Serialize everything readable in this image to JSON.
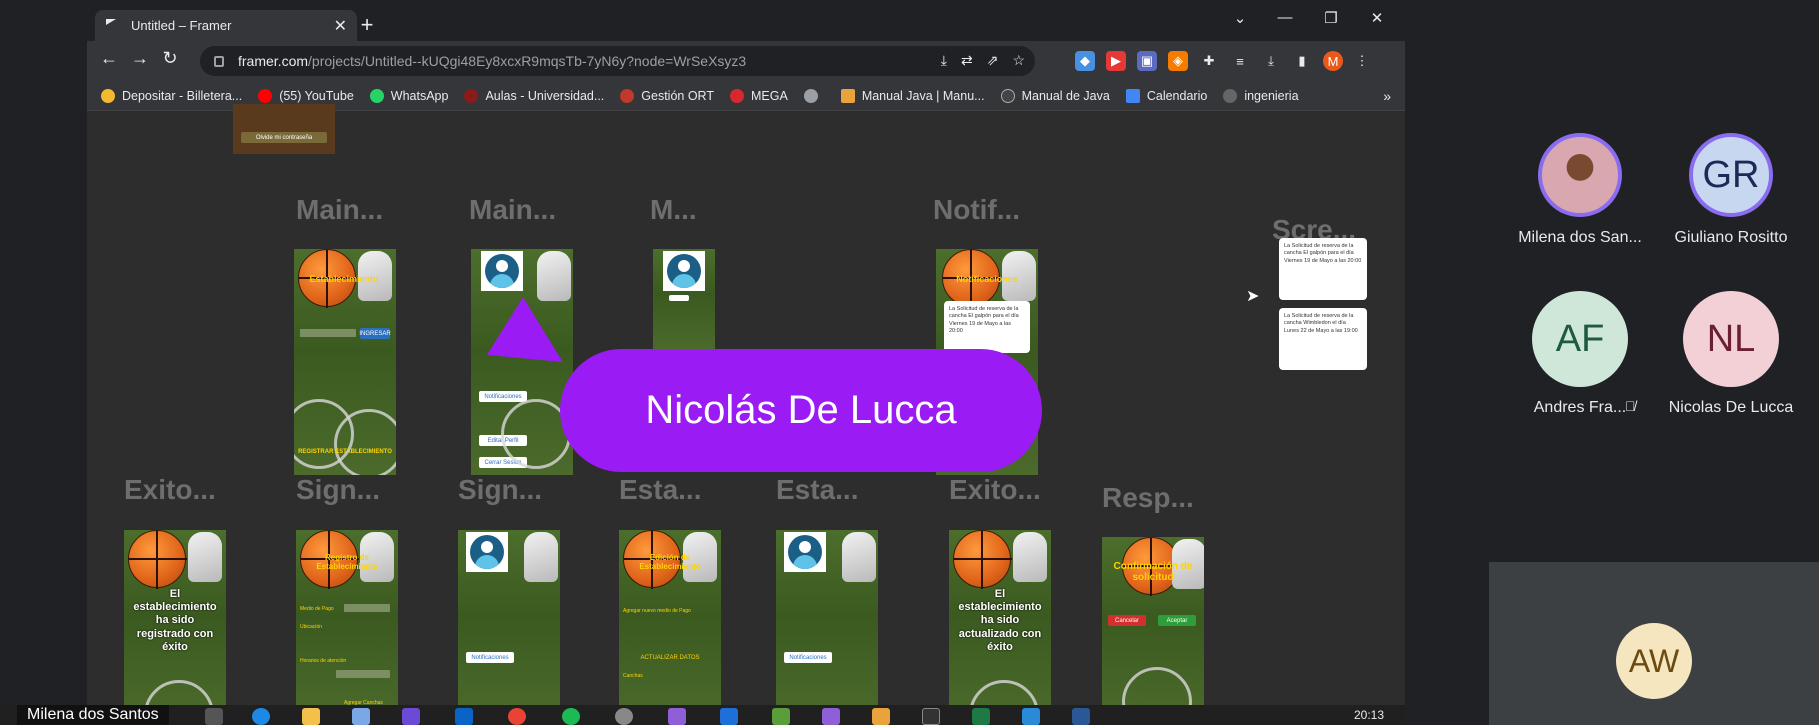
{
  "browser": {
    "tab_title": "Untitled – Framer",
    "url_host": "framer.com",
    "url_path": "/projects/Untitled--kUQgi48Ey8xcxR9mqsTb-7yN6y?node=WrSeXsyz3",
    "profile_initial": "M"
  },
  "bookmarks": [
    {
      "label": "Depositar - Billetera...",
      "color": "#f3ba2f"
    },
    {
      "label": "(55) YouTube",
      "color": "#ff0000"
    },
    {
      "label": "WhatsApp",
      "color": "#25d366"
    },
    {
      "label": "Aulas - Universidad...",
      "color": "#8b1a1a"
    },
    {
      "label": "Gestión ORT",
      "color": "#c0392b"
    },
    {
      "label": "MEGA",
      "color": "#d9272e"
    },
    {
      "label": "",
      "color": "#9aa0a6"
    },
    {
      "label": "Manual Java | Manu...",
      "color": "#e8a33d"
    },
    {
      "label": "Manual de Java",
      "color": "#444"
    },
    {
      "label": "Calendario",
      "color": "#4285f4"
    },
    {
      "label": "ingenieria",
      "color": "#666"
    }
  ],
  "canvas": {
    "top_thumb_button": "Olvide mi contraseña",
    "row1_titles": [
      "Main...",
      "Main...",
      "M...",
      "Notif...",
      "Scre..."
    ],
    "row2_titles": [
      "Exito...",
      "Sign...",
      "Sign...",
      "Esta...",
      "Esta...",
      "Exito...",
      "Resp..."
    ],
    "screen_texts": {
      "estab_heading": "Establecimiento",
      "ingresar": "INGRESAR",
      "registrar": "REGISTRAR ESTABLECIMIENTO",
      "notificaciones_btn": "Notificaciones",
      "editar_perfil": "Editar Perfil",
      "cerrar_sesion": "Cerrar Sesión",
      "notificaciones_title": "Notificaciones",
      "notif_1": "La Solicitud de reserva de la cancha El galpón para el día Viernes 19 de Mayo a las 20:00",
      "notif_2": "La Solicitud de reserva de la cancha Wimbledon el día Lunes 22 de Mayo a las 19:00",
      "exito_1": "El establecimiento ha sido registrado con éxito",
      "registro_title": "Registro de Establecimiento",
      "medio_pago": "Medio de Pago",
      "ubicacion": "Ubicación",
      "horarios": "Horarios de atención",
      "agregar_canchas": "Agregar Canchas",
      "edicion_title": "Edición de Establecimiento",
      "agregar_medio": "Agregar nuevo medio de Pago",
      "actualizar_datos": "ACTUALIZAR DATOS",
      "canchas": "Canchas",
      "exito_2": "El establecimiento ha sido actualizado con éxito",
      "confirmacion": "Confirmación de solicitud",
      "cancelar": "Cancelar",
      "aceptar": "Aceptar"
    }
  },
  "speaker_label": "Nicolás De Lucca",
  "participants": [
    {
      "initials": "",
      "name": "Milena dos San...",
      "bg": "#d9a7b0",
      "fg": "#333"
    },
    {
      "initials": "GR",
      "name": "Giuliano Rositto",
      "bg": "#c7d7ef",
      "fg": "#1a2b57"
    },
    {
      "initials": "AF",
      "name": "Andres Fra...",
      "bg": "#cfe7d9",
      "fg": "#1e5a3b"
    },
    {
      "initials": "NL",
      "name": "Nicolas De Lucca",
      "bg": "#f2d0d6",
      "fg": "#6b1f33"
    }
  ],
  "aw_initials": "AW",
  "presenter_name": "Milena dos Santos",
  "clock": "20:13"
}
